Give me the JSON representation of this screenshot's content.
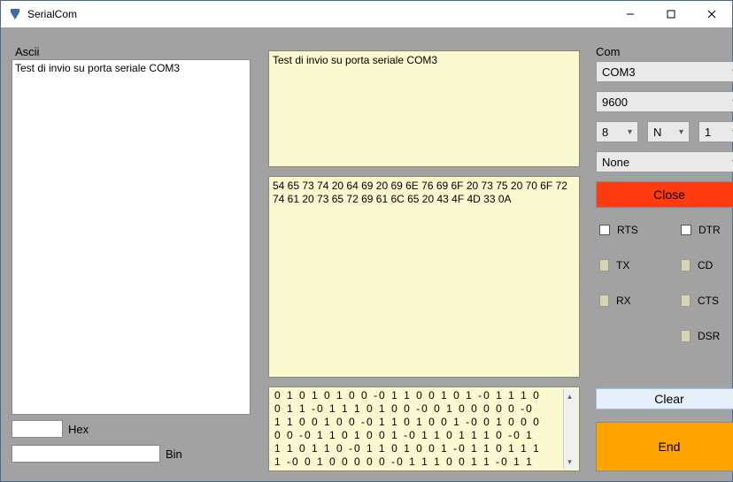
{
  "window": {
    "title": "SerialCom"
  },
  "ascii": {
    "label": "Ascii",
    "input_value": "Test di invio su porta seriale COM3"
  },
  "hex": {
    "label": "Hex"
  },
  "bin": {
    "label": "Bin"
  },
  "outputs": {
    "ascii_echo": "Test di invio su porta seriale COM3",
    "hex_dump": "54 65 73 74 20 64 69 20 69 6E 76 69 6F 20 73 75 20 70 6F 72 74 61 20 73 65 72 69 61 6C 65 20 43 4F 4D 33 0A",
    "bin_rows": [
      " 0  1  0  1  0  1  0  0   -0  1  1  0  0  1  0  1   -0  1  1  1  0",
      " 0  1  1   -0  1  1  1  0  1  0  0   -0  0  1  0  0  0  0  0   -0",
      " 1  1  0  0  1  0  0   -0  1  1  0  1  0  0  1   -0  0  1  0  0  0",
      " 0  0   -0  1  1  0  1  0  0  1   -0  1  1  0  1  1  1  0   -0  1",
      " 1  1  0  1  1  0   -0  1  1  0  1  0  0  1   -0  1  1  0  1  1  1",
      " 1   -0  0  1  0  0  0  0  0   -0  1  1  1  0  0  1  1   -0  1  1"
    ]
  },
  "com": {
    "label": "Com",
    "port": "COM3",
    "baud": "9600",
    "databits": "8",
    "parity": "N",
    "stopbits": "1",
    "flow": "None",
    "rts": "RTS",
    "dtr": "DTR",
    "tx": "TX",
    "rx": "RX",
    "cd": "CD",
    "cts": "CTS",
    "dsr": "DSR"
  },
  "buttons": {
    "close": "Close",
    "clear": "Clear",
    "end": "End"
  }
}
